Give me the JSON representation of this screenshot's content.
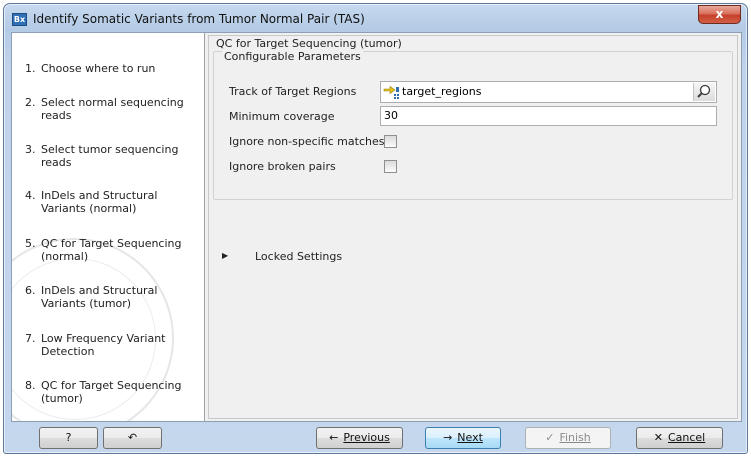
{
  "window": {
    "title": "Identify Somatic Variants from Tumor Normal Pair (TAS)",
    "app_icon_text": "Bx",
    "close_glyph": "x"
  },
  "steps": [
    {
      "num": "1.",
      "label": "Choose where to run"
    },
    {
      "num": "2.",
      "label": "Select normal sequencing reads"
    },
    {
      "num": "3.",
      "label": "Select tumor sequencing reads"
    },
    {
      "num": "4.",
      "label": "InDels and Structural Variants (normal)"
    },
    {
      "num": "5.",
      "label": "QC for Target Sequencing (normal)"
    },
    {
      "num": "6.",
      "label": "InDels and Structural Variants (tumor)"
    },
    {
      "num": "7.",
      "label": "Low Frequency Variant Detection"
    },
    {
      "num": "8.",
      "label": "QC for Target Sequencing (tumor)"
    }
  ],
  "panel": {
    "title": "QC for Target Sequencing (tumor)",
    "group_title": "Configurable Parameters",
    "params": {
      "track_label": "Track of Target Regions",
      "track_value": "target_regions",
      "coverage_label": "Minimum coverage",
      "coverage_value": "30",
      "nonspecific_label": "Ignore non-specific matches",
      "nonspecific_checked": false,
      "broken_label": "Ignore broken pairs",
      "broken_checked": false
    },
    "locked_label": "Locked Settings",
    "locked_glyph": "▶"
  },
  "buttons": {
    "help": "?",
    "reset_glyph": "↶",
    "previous": {
      "icon": "←",
      "label": "Previous"
    },
    "next": {
      "icon": "→",
      "label": "Next"
    },
    "finish": {
      "icon": "✓",
      "label": "Finish"
    },
    "cancel": {
      "icon": "✕",
      "label": "Cancel"
    }
  },
  "colors": {
    "accent": "#3c7fb1",
    "close": "#c6402a"
  },
  "icons": {
    "track": "track-regions-icon",
    "browse": "browse-magnifier-icon"
  }
}
